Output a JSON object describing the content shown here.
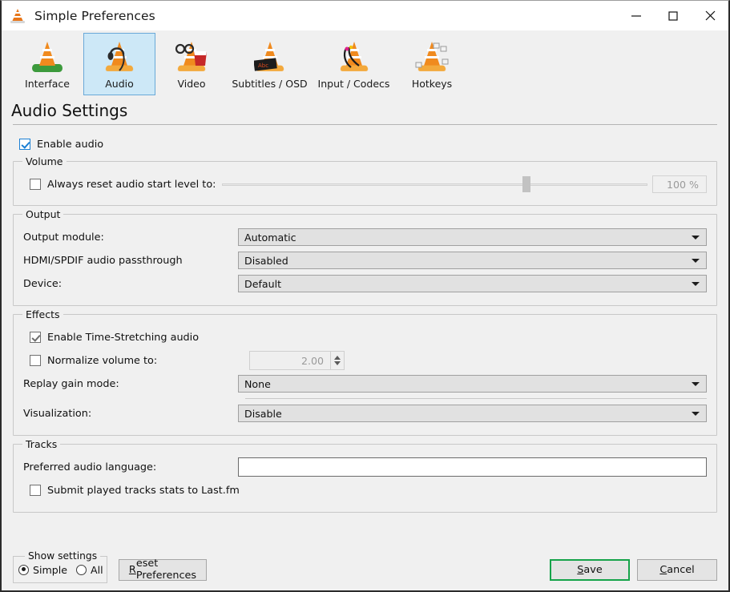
{
  "window": {
    "title": "Simple Preferences",
    "app_icon": "vlc-cone-icon",
    "controls": {
      "minimize": "minimize-icon",
      "maximize": "maximize-icon",
      "close": "close-icon"
    }
  },
  "toolbar": {
    "items": [
      {
        "label": "Interface",
        "icon": "vlc-cone-interface-icon",
        "selected": false
      },
      {
        "label": "Audio",
        "icon": "vlc-cone-headphones-icon",
        "selected": true
      },
      {
        "label": "Video",
        "icon": "vlc-cone-glasses-icon",
        "selected": false
      },
      {
        "label": "Subtitles / OSD",
        "icon": "vlc-cone-subtitles-icon",
        "selected": false
      },
      {
        "label": "Input / Codecs",
        "icon": "vlc-cone-cables-icon",
        "selected": false
      },
      {
        "label": "Hotkeys",
        "icon": "vlc-cone-keys-icon",
        "selected": false
      }
    ]
  },
  "page": {
    "title": "Audio Settings"
  },
  "enable_audio": {
    "label": "Enable audio",
    "checked": true
  },
  "volume": {
    "group_label": "Volume",
    "reset_label": "Always reset audio start level to:",
    "reset_checked": false,
    "slider_value": 100,
    "slider_min": 0,
    "slider_max": 140,
    "percent_text": "100 %"
  },
  "output": {
    "group_label": "Output",
    "rows": [
      {
        "label": "Output module:",
        "value": "Automatic"
      },
      {
        "label": "HDMI/SPDIF audio passthrough",
        "value": "Disabled"
      },
      {
        "label": "Device:",
        "value": "Default"
      }
    ]
  },
  "effects": {
    "group_label": "Effects",
    "time_stretch": {
      "label": "Enable Time-Stretching audio",
      "checked": true
    },
    "normalize": {
      "label": "Normalize volume to:",
      "checked": false,
      "value": "2.00"
    },
    "replay_gain": {
      "label": "Replay gain mode:",
      "value": "None"
    },
    "visualization": {
      "label": "Visualization:",
      "value": "Disable"
    }
  },
  "tracks": {
    "group_label": "Tracks",
    "preferred_language": {
      "label": "Preferred audio language:",
      "value": "",
      "placeholder": ""
    },
    "lastfm": {
      "label": "Submit played tracks stats to Last.fm",
      "checked": false
    }
  },
  "bottom": {
    "show_settings_label": "Show settings",
    "simple_label": "Simple",
    "all_label": "All",
    "simple_selected": true,
    "all_selected": false,
    "reset_accel": "R",
    "reset_rest": "eset Preferences",
    "save_accel": "S",
    "save_rest": "ave",
    "cancel_accel": "C",
    "cancel_rest": "ancel"
  },
  "colors": {
    "window_bg": "#f0f0f0",
    "titlebar_bg": "#ffffff",
    "tab_selected_bg": "#cde8f7",
    "tab_selected_border": "#6aa9d8",
    "checkbox_accent": "#1a7fd4",
    "save_focus_border": "#16a34a",
    "combo_bg": "#e1e1e1",
    "group_border": "#c8c8c8"
  }
}
